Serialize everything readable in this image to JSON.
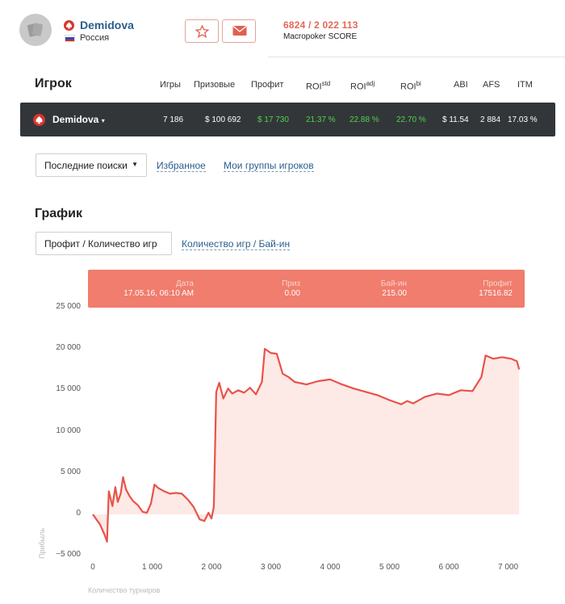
{
  "player": {
    "name": "Demidova",
    "country": "Россия"
  },
  "score": {
    "value": "6824 / 2 022 113",
    "label": "Macropoker SCORE"
  },
  "stats": {
    "title": "Игрок",
    "columns": [
      "Игры",
      "Призовые",
      "Профит",
      "ROI",
      "ROI",
      "ROI",
      "ABI",
      "AFS",
      "ITM"
    ],
    "roi_sup": [
      "std",
      "adj",
      "bi"
    ],
    "row": {
      "name": "Demidova",
      "values": [
        "7 186",
        "$ 100 692",
        "$ 17 730",
        "21.37 %",
        "22.88 %",
        "22.70 %",
        "$ 11.54",
        "2 884",
        "17.03 %"
      ]
    }
  },
  "filters": {
    "select_label": "Последние поиски",
    "link1": "Избранное",
    "link2": "Мои группы игроков"
  },
  "chart_section": {
    "title": "График",
    "tab_active": "Профит / Количество игр",
    "tab_link": "Количество игр / Бай-ин"
  },
  "tooltip": {
    "date_label": "Дата",
    "date_value": "17.05.16, 06:10 AM",
    "prize_label": "Приз",
    "prize_value": "0.00",
    "buyin_label": "Бай-ин",
    "buyin_value": "215.00",
    "profit_label": "Профит",
    "profit_value": "17516.82"
  },
  "chart_data": {
    "type": "area",
    "xlabel": "Количество турниров",
    "ylabel": "Прибыль",
    "xlim": [
      0,
      7186
    ],
    "ylim": [
      -5000,
      25000
    ],
    "x_ticks": [
      "0",
      "1 000",
      "2 000",
      "3 000",
      "4 000",
      "5 000",
      "6 000",
      "7 000"
    ],
    "y_ticks": [
      "25 000",
      "20 000",
      "15 000",
      "10 000",
      "5 000",
      "0",
      "−5 000"
    ],
    "x_tick_values": [
      0,
      1000,
      2000,
      3000,
      4000,
      5000,
      6000,
      7000
    ],
    "y_tick_values": [
      25000,
      20000,
      15000,
      10000,
      5000,
      0,
      -5000
    ],
    "line_color": "#e8534a",
    "fill_color": "#fde9e6",
    "points": [
      [
        0,
        0
      ],
      [
        120,
        -1200
      ],
      [
        200,
        -2500
      ],
      [
        240,
        -3300
      ],
      [
        270,
        2800
      ],
      [
        330,
        1000
      ],
      [
        380,
        3300
      ],
      [
        420,
        1500
      ],
      [
        470,
        2500
      ],
      [
        510,
        4500
      ],
      [
        560,
        3000
      ],
      [
        620,
        2200
      ],
      [
        680,
        1600
      ],
      [
        760,
        1100
      ],
      [
        840,
        300
      ],
      [
        910,
        200
      ],
      [
        980,
        1300
      ],
      [
        1040,
        3600
      ],
      [
        1100,
        3200
      ],
      [
        1200,
        2800
      ],
      [
        1300,
        2500
      ],
      [
        1400,
        2600
      ],
      [
        1500,
        2500
      ],
      [
        1600,
        1800
      ],
      [
        1700,
        900
      ],
      [
        1800,
        -600
      ],
      [
        1880,
        -800
      ],
      [
        1950,
        200
      ],
      [
        2000,
        -500
      ],
      [
        2040,
        900
      ],
      [
        2080,
        14800
      ],
      [
        2130,
        15900
      ],
      [
        2200,
        14000
      ],
      [
        2280,
        15200
      ],
      [
        2350,
        14600
      ],
      [
        2450,
        15000
      ],
      [
        2550,
        14700
      ],
      [
        2650,
        15300
      ],
      [
        2750,
        14500
      ],
      [
        2850,
        16000
      ],
      [
        2900,
        20000
      ],
      [
        3000,
        19500
      ],
      [
        3100,
        19400
      ],
      [
        3200,
        17000
      ],
      [
        3300,
        16600
      ],
      [
        3400,
        16000
      ],
      [
        3600,
        15700
      ],
      [
        3800,
        16100
      ],
      [
        4000,
        16300
      ],
      [
        4200,
        15700
      ],
      [
        4400,
        15200
      ],
      [
        4600,
        14800
      ],
      [
        4800,
        14400
      ],
      [
        5000,
        13800
      ],
      [
        5200,
        13300
      ],
      [
        5300,
        13700
      ],
      [
        5400,
        13400
      ],
      [
        5600,
        14200
      ],
      [
        5800,
        14600
      ],
      [
        6000,
        14400
      ],
      [
        6200,
        15000
      ],
      [
        6400,
        14900
      ],
      [
        6550,
        16600
      ],
      [
        6620,
        19200
      ],
      [
        6750,
        18800
      ],
      [
        6900,
        19000
      ],
      [
        7050,
        18800
      ],
      [
        7150,
        18500
      ],
      [
        7186,
        17517
      ]
    ]
  }
}
